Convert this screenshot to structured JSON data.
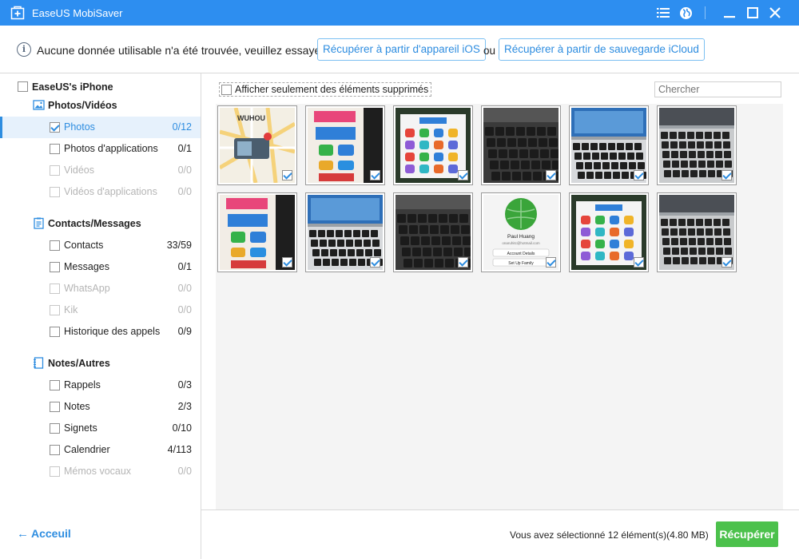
{
  "window": {
    "title": "EaseUS MobiSaver",
    "colors": {
      "accent": "#2d8ef0",
      "link": "#2e8de0",
      "recover": "#4cc14c"
    }
  },
  "titlebar_icons": [
    "list-icon",
    "globe-icon",
    "minimize-icon",
    "maximize-icon",
    "close-icon"
  ],
  "info": {
    "message": "Aucune donnée utilisable n'a été trouvée, veuillez essayer",
    "ios_button": "Récupérer à partir d'appareil iOS",
    "or": "ou",
    "icloud_button": "Récupérer à partir de sauvegarde iCloud"
  },
  "sidebar": {
    "root": "EaseUS's iPhone",
    "categories": [
      {
        "name": "Photos/Vidéos",
        "icon": "image-icon",
        "items": [
          {
            "label": "Photos",
            "count": "0/12",
            "checked": true,
            "active": true,
            "disabled": false
          },
          {
            "label": "Photos d'applications",
            "count": "0/1",
            "checked": false,
            "active": false,
            "disabled": false
          },
          {
            "label": "Vidéos",
            "count": "0/0",
            "checked": false,
            "active": false,
            "disabled": true
          },
          {
            "label": "Vidéos d'applications",
            "count": "0/0",
            "checked": false,
            "active": false,
            "disabled": true
          }
        ]
      },
      {
        "name": "Contacts/Messages",
        "icon": "contacts-icon",
        "items": [
          {
            "label": "Contacts",
            "count": "33/59",
            "checked": false,
            "active": false,
            "disabled": false
          },
          {
            "label": "Messages",
            "count": "0/1",
            "checked": false,
            "active": false,
            "disabled": false
          },
          {
            "label": "WhatsApp",
            "count": "0/0",
            "checked": false,
            "active": false,
            "disabled": true
          },
          {
            "label": "Kik",
            "count": "0/0",
            "checked": false,
            "active": false,
            "disabled": true
          },
          {
            "label": "Historique des appels",
            "count": "0/9",
            "checked": false,
            "active": false,
            "disabled": false
          }
        ]
      },
      {
        "name": "Notes/Autres",
        "icon": "notebook-icon",
        "items": [
          {
            "label": "Rappels",
            "count": "0/3",
            "checked": false,
            "active": false,
            "disabled": false
          },
          {
            "label": "Notes",
            "count": "2/3",
            "checked": false,
            "active": false,
            "disabled": false
          },
          {
            "label": "Signets",
            "count": "0/10",
            "checked": false,
            "active": false,
            "disabled": false
          },
          {
            "label": "Calendrier",
            "count": "4/113",
            "checked": false,
            "active": false,
            "disabled": false
          },
          {
            "label": "Mémos vocaux",
            "count": "0/0",
            "checked": false,
            "active": false,
            "disabled": true
          }
        ]
      }
    ],
    "back": "Acceuil"
  },
  "main": {
    "filter_label": "Afficher seulement des éléments supprimés",
    "search_placeholder": "Chercher",
    "thumbnails": [
      {
        "kind": "map",
        "text": "WUHOU",
        "checked": true
      },
      {
        "kind": "appstore",
        "checked": true
      },
      {
        "kind": "appgrid",
        "checked": true
      },
      {
        "kind": "keyboard-dark",
        "checked": true
      },
      {
        "kind": "laptop",
        "checked": true
      },
      {
        "kind": "keyboard",
        "checked": true
      },
      {
        "kind": "appstore",
        "checked": true
      },
      {
        "kind": "laptop",
        "checked": true
      },
      {
        "kind": "keyboard-dark",
        "checked": true
      },
      {
        "kind": "profile",
        "name": "Paul Huang",
        "email": "onaruhitc@hotmail.com",
        "button1": "Account Details",
        "button2": "Set Up Family",
        "checked": true
      },
      {
        "kind": "appgrid",
        "checked": true
      },
      {
        "kind": "keyboard",
        "checked": true
      }
    ]
  },
  "footer": {
    "selection": "Vous avez sélectionné 12 élément(s)(4.80 MB)",
    "recover_button": "Récupérer"
  }
}
